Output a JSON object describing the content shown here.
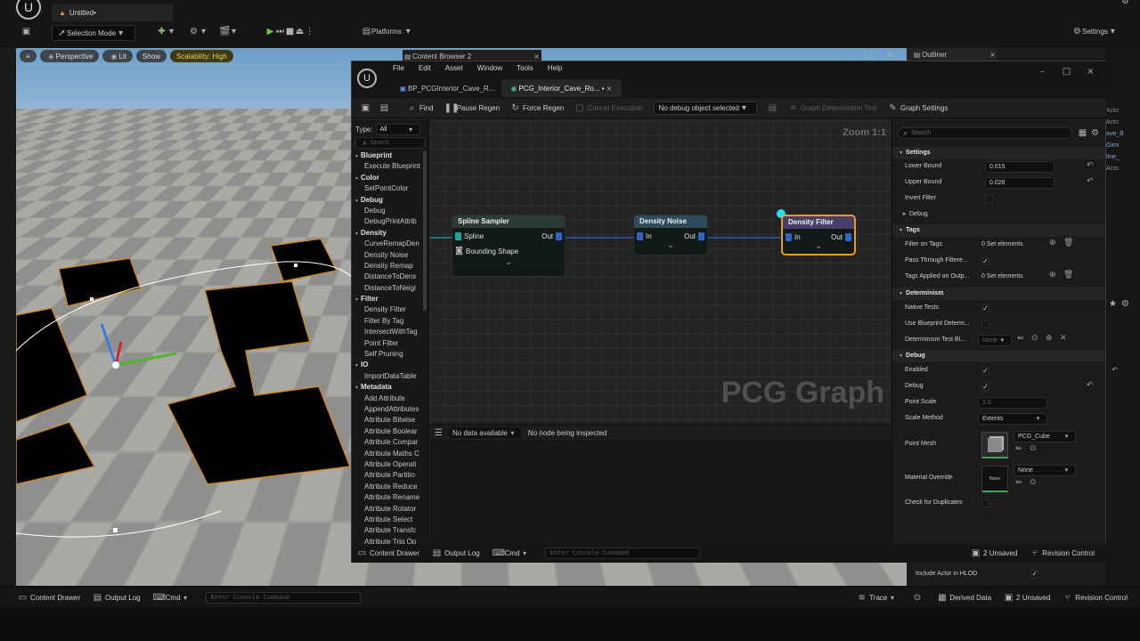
{
  "app": {
    "doc_tab": "Untitled•",
    "selection_mode": "Selection Mode",
    "platforms": "Platforms",
    "settings": "Settings"
  },
  "viewport": {
    "perspective": "Perspective",
    "lit": "Lit",
    "show": "Show",
    "scalability": "Scalability: High"
  },
  "background_tabs": {
    "content_browser": "Content Browser 2",
    "outliner": "Outliner",
    "include_actor": "Include Actor in HLOD",
    "outliner_fragments": [
      "Acto",
      "Acto",
      "ave_B",
      "Gimi",
      "line_",
      "Acto"
    ]
  },
  "pcg": {
    "menu": [
      "File",
      "Edit",
      "Asset",
      "Window",
      "Tools",
      "Help"
    ],
    "tabs": [
      "BP_PCGInterior_Cave_R...",
      "PCG_Interior_Cave_Ro... •"
    ],
    "toolbar": {
      "find": "Find",
      "pause": "Pause Regen",
      "force": "Force Regen",
      "cancel": "Cancel Execution",
      "debug_object": "No debug object selected",
      "determinism": "Graph Determinism Test",
      "graph_settings": "Graph Settings"
    },
    "palette": {
      "type_label": "Type:",
      "type_value": "All",
      "search_placeholder": "Search",
      "items": [
        {
          "t": "Blueprint",
          "cat": true
        },
        {
          "t": "Execute Blueprint"
        },
        {
          "t": "Color",
          "cat": true
        },
        {
          "t": "SetPointColor"
        },
        {
          "t": "Debug",
          "cat": true
        },
        {
          "t": "Debug"
        },
        {
          "t": "DebugPrintAttrib"
        },
        {
          "t": "Density",
          "cat": true
        },
        {
          "t": "CurveRemapDen"
        },
        {
          "t": "Density Noise"
        },
        {
          "t": "Density Remap"
        },
        {
          "t": "DistanceToDens"
        },
        {
          "t": "DistanceToNeigl"
        },
        {
          "t": "Filter",
          "cat": true
        },
        {
          "t": "Density Filter"
        },
        {
          "t": "Filter By Tag"
        },
        {
          "t": "IntersectWithTag"
        },
        {
          "t": "Point Filter"
        },
        {
          "t": "Self Pruning"
        },
        {
          "t": "IO",
          "cat": true
        },
        {
          "t": "ImportDataTable"
        },
        {
          "t": "Metadata",
          "cat": true
        },
        {
          "t": "Add Attribute"
        },
        {
          "t": "AppendAttributes"
        },
        {
          "t": "Attribute Bitwise"
        },
        {
          "t": "Attribute Boolear"
        },
        {
          "t": "Attribute Compar"
        },
        {
          "t": "Attribute Maths C"
        },
        {
          "t": "Attribute Operati"
        },
        {
          "t": "Attribute Partitio"
        },
        {
          "t": "Attribute Reduce"
        },
        {
          "t": "Attribute Rename"
        },
        {
          "t": "Attribute Rotator"
        },
        {
          "t": "Attribute Select"
        },
        {
          "t": "Attribute Transfc"
        },
        {
          "t": "Attribute Trig Op"
        }
      ]
    },
    "graph": {
      "zoom": "Zoom 1:1",
      "watermark": "PCG Graph",
      "nodes": {
        "spline_sampler": {
          "title": "Spline Sampler",
          "in1": "Spline",
          "in2": "Bounding Shape",
          "out": "Out"
        },
        "density_noise": {
          "title": "Density Noise",
          "in": "In",
          "out": "Out"
        },
        "density_filter": {
          "title": "Density Filter",
          "in": "In",
          "out": "Out"
        }
      }
    },
    "inspect": {
      "data": "No data available",
      "status": "No node being inspected"
    },
    "details": {
      "search_placeholder": "Search",
      "settings": "Settings",
      "lower_bound_label": "Lower Bound",
      "lower_bound": "0.015",
      "upper_bound_label": "Upper Bound",
      "upper_bound": "0.028",
      "invert_filter": "Invert Filter",
      "debug_sub": "Debug",
      "tags": "Tags",
      "filter_on_tags": "Filter on Tags",
      "filter_on_tags_val": "0 Set elements",
      "pass_through": "Pass Through Filtere...",
      "tags_applied": "Tags Applied on Outp...",
      "tags_applied_val": "0 Set elements",
      "determinism": "Determinism",
      "native_tests": "Native Tests",
      "use_bp_determ": "Use Blueprint Determ...",
      "determ_test_bp": "Determinism Test Bl...",
      "none": "None",
      "debug": "Debug",
      "enabled": "Enabled",
      "debug_prop": "Debug",
      "point_scale": "Point Scale",
      "point_scale_val": "1.0",
      "scale_method": "Scale Method",
      "scale_method_val": "Extents",
      "point_mesh": "Point Mesh",
      "point_mesh_val": "PCG_Cube",
      "material_override": "Material Override",
      "material_val": "None",
      "check_duplicates": "Check for Duplicates"
    },
    "bottom": {
      "content_drawer": "Content Drawer",
      "output_log": "Output Log",
      "cmd": "Cmd",
      "console_placeholder": "Enter Console Command",
      "unsaved": "2 Unsaved",
      "revision": "Revision Control"
    }
  },
  "main_bottom": {
    "content_drawer": "Content Drawer",
    "output_log": "Output Log",
    "cmd": "Cmd",
    "console_placeholder": "Enter Console Command",
    "trace": "Trace",
    "derived_data": "Derived Data",
    "unsaved": "2 Unsaved",
    "revision": "Revision Control"
  }
}
